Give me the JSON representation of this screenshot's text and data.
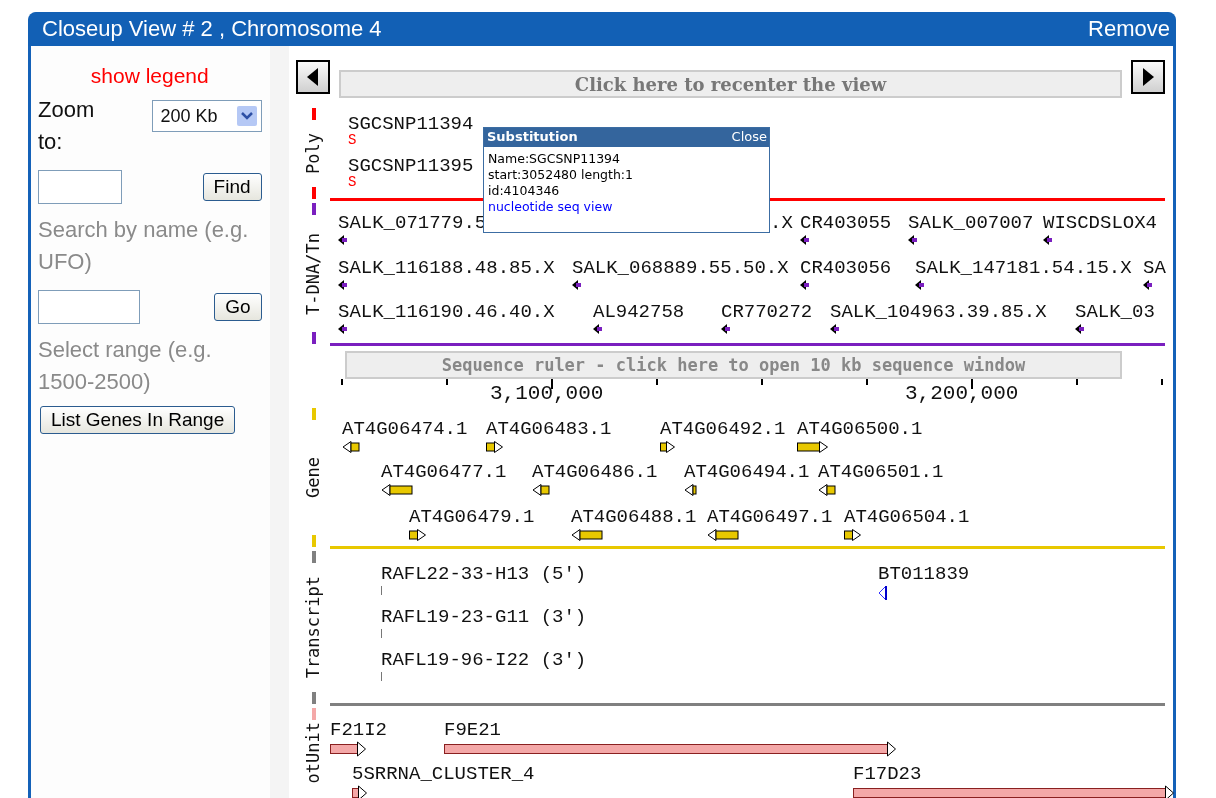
{
  "panel": {
    "title": "Closeup View # 2 , Chromosome 4",
    "remove": "Remove"
  },
  "sidebar": {
    "legend_link": "show legend",
    "zoom_label": "Zoom to:",
    "zoom_select": "200 Kb",
    "find_button": "Find",
    "search_hint": "Search by name (e.g. UFO)",
    "go_button": "Go",
    "range_hint": "Select range (e.g. 1500-2500)",
    "list_button": "List Genes In Range"
  },
  "navigation": {
    "recenter": "Click here to recenter the view"
  },
  "tracks": [
    {
      "kind": "poly",
      "name": "Poly",
      "color": "#ff0000",
      "features": [
        {
          "label": "SGCSNP11394",
          "mark": "S"
        },
        {
          "label": "SGCSNP11395",
          "mark": "S"
        }
      ]
    },
    {
      "kind": "insertion",
      "name": "T-DNA/Tn",
      "color": "#7a1fbf",
      "features": [
        {
          "label": "SALK_071779.5"
        },
        {
          "label": ".X"
        },
        {
          "label": "CR403055"
        },
        {
          "label": "SALK_007007"
        },
        {
          "label": "WISCDSLOX4"
        },
        {
          "label": "SALK_116188.48.85.X"
        },
        {
          "label": "SALK_068889.55.50.X"
        },
        {
          "label": "CR403056"
        },
        {
          "label": "SALK_147181.54.15.X"
        },
        {
          "label": "SA"
        },
        {
          "label": "SALK_116190.46.40.X"
        },
        {
          "label": "AL942758"
        },
        {
          "label": "CR770272"
        },
        {
          "label": "SALK_104963.39.85.X"
        },
        {
          "label": "SALK_03"
        }
      ]
    },
    {
      "kind": "ruler",
      "label": "Sequence ruler - click here to open 10 kb sequence window",
      "ticks": [
        "3,100,000",
        "3,200,000"
      ]
    },
    {
      "kind": "gene",
      "name": "Gene",
      "color": "#e8c800",
      "features": [
        {
          "label": "AT4G06474.1",
          "reverse": true
        },
        {
          "label": "AT4G06483.1",
          "reverse": false
        },
        {
          "label": "AT4G06492.1",
          "reverse": false
        },
        {
          "label": "AT4G06500.1",
          "reverse": false
        },
        {
          "label": "AT4G06477.1",
          "reverse": true
        },
        {
          "label": "AT4G06486.1",
          "reverse": true
        },
        {
          "label": "AT4G06494.1",
          "reverse": true
        },
        {
          "label": "AT4G06501.1",
          "reverse": true
        },
        {
          "label": "AT4G06479.1",
          "reverse": false
        },
        {
          "label": "AT4G06488.1",
          "reverse": true
        },
        {
          "label": "AT4G06497.1",
          "reverse": true
        },
        {
          "label": "AT4G06504.1",
          "reverse": false
        }
      ]
    },
    {
      "kind": "transcript",
      "name": "Transcript",
      "color": "#808080",
      "features": [
        {
          "label": "RAFL22-33-H13 (5')"
        },
        {
          "label": "BT011839"
        },
        {
          "label": "RAFL19-23-G11 (3')"
        },
        {
          "label": "RAFL19-96-I22 (3')"
        }
      ]
    },
    {
      "kind": "clone",
      "name": "otUnit",
      "color": "#f4a8a8",
      "features": [
        {
          "label": "F21I2"
        },
        {
          "label": "F9E21"
        },
        {
          "label": "5SRRNA_CLUSTER_4"
        },
        {
          "label": "F17D23"
        }
      ]
    }
  ],
  "popup": {
    "title": "Substitution",
    "close": "Close",
    "lines": [
      "Name:SGCSNP11394",
      "start:3052480 length:1",
      "id:4104346"
    ],
    "link": "nucleotide seq view"
  }
}
